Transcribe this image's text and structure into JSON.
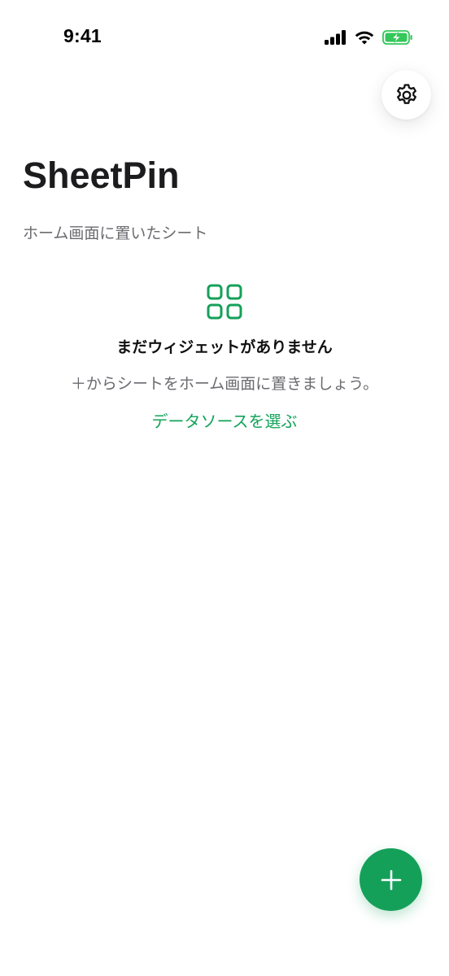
{
  "status_bar": {
    "time": "9:41",
    "signal_icon": "cellular-signal-icon",
    "wifi_icon": "wifi-icon",
    "battery_icon": "battery-charging-icon",
    "battery_color": "#34c759"
  },
  "header": {
    "title": "SheetPin",
    "subtitle": "ホーム画面に置いたシート",
    "settings_icon": "gear-icon"
  },
  "empty_state": {
    "icon": "grid-icon",
    "title": "まだウィジェットがありません",
    "message": "＋からシートをホーム画面に置きましょう。",
    "link_label": "データソースを選ぶ"
  },
  "fab": {
    "icon": "plus-icon"
  },
  "colors": {
    "accent": "#15a05a",
    "link": "#13a35a",
    "secondary_text": "#6b6b70",
    "background": "#ffffff"
  }
}
